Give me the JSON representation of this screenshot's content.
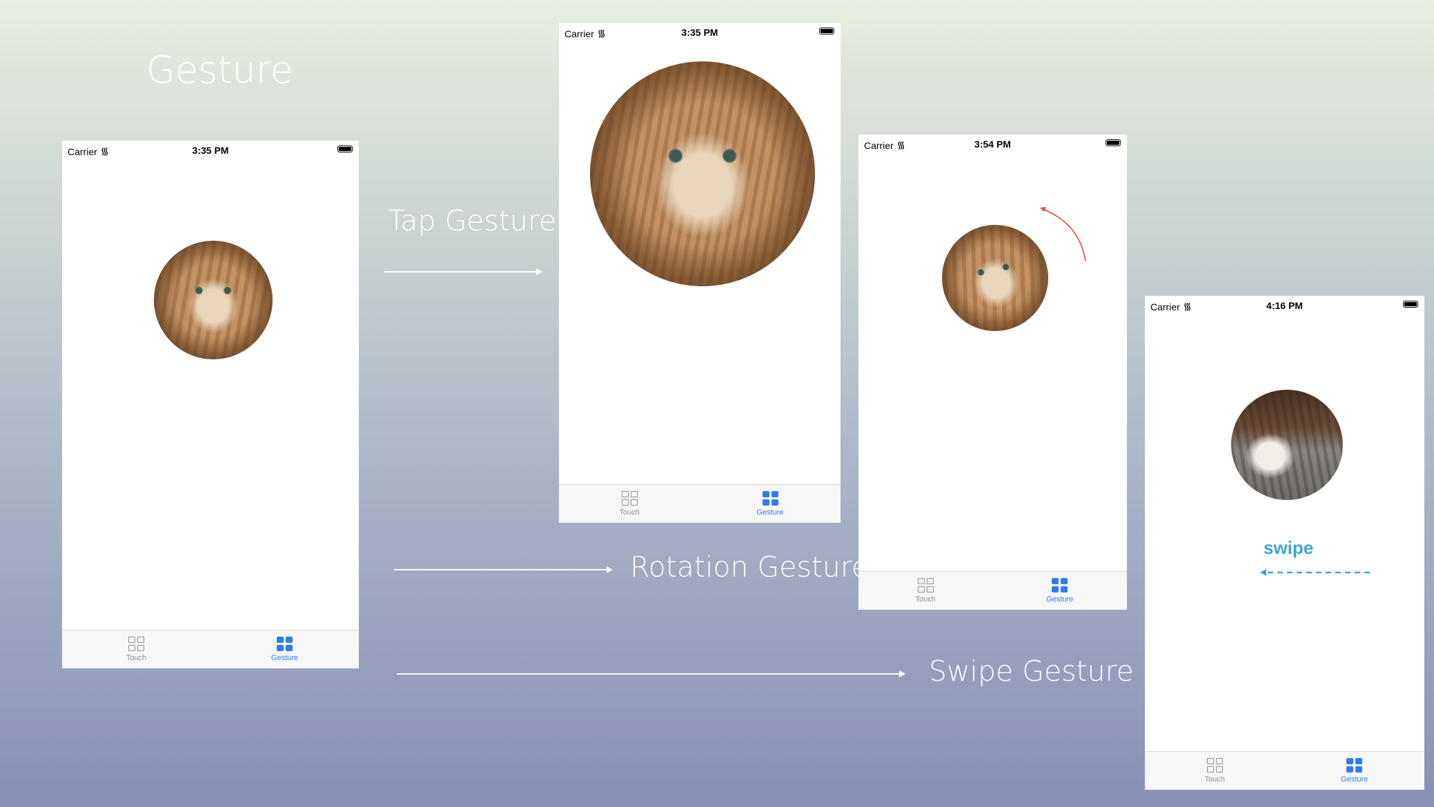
{
  "title": "Gesture",
  "labels": {
    "tap": "Tap Gesture",
    "rotation": "Rotation Gesture",
    "swipe": "Swipe Gesture"
  },
  "phones": [
    {
      "carrier": "Carrier",
      "time": "3:35 PM"
    },
    {
      "carrier": "Carrier",
      "time": "3:35 PM"
    },
    {
      "carrier": "Carrier",
      "time": "3:54 PM"
    },
    {
      "carrier": "Carrier",
      "time": "4:16 PM",
      "swipe_label": "swipe"
    }
  ],
  "tabs": [
    {
      "label": "Touch"
    },
    {
      "label": "Gesture"
    }
  ],
  "colors": {
    "accent": "#2f7bf5",
    "swipe": "#3fa3d8",
    "rotation_arrow": "#e8463a"
  }
}
